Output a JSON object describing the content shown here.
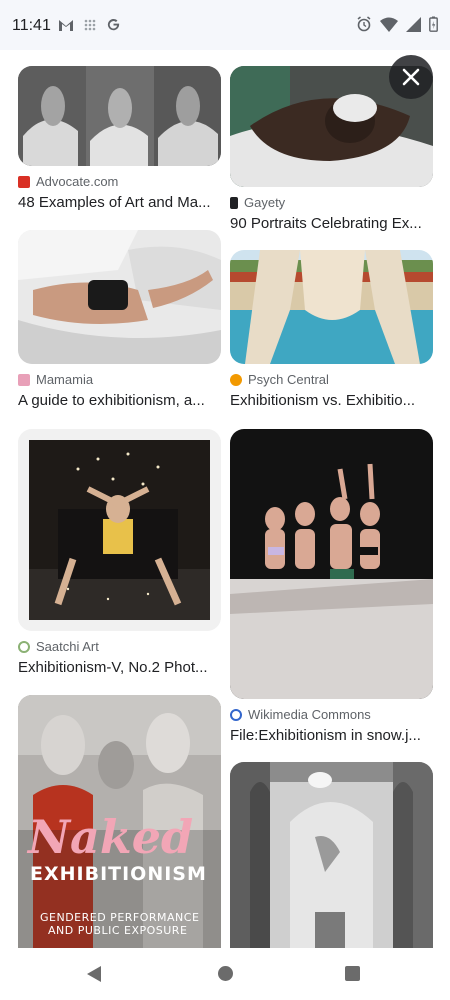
{
  "status_bar": {
    "time": "11:41",
    "left_icons": [
      "gmail-icon",
      "grid-dots-icon",
      "google-icon"
    ],
    "right_icons": [
      "alarm-icon",
      "wifi-icon",
      "signal-icon",
      "battery-icon"
    ]
  },
  "close_button": {
    "icon": "close-icon"
  },
  "results": [
    {
      "source": "Advocate.com",
      "title": "48 Examples of Art and Ma...",
      "fav_color": "#d93025"
    },
    {
      "source": "Gayety",
      "title": "90 Portraits Celebrating Ex...",
      "fav_color": "#202124"
    },
    {
      "source": "Mamamia",
      "title": "A guide to exhibitionism, a...",
      "fav_color": "#e8a0b8"
    },
    {
      "source": "Psych Central",
      "title": "Exhibitionism vs. Exhibitio...",
      "fav_color": "#f29900"
    },
    {
      "source": "Saatchi Art",
      "title": "Exhibitionism-V, No.2 Phot...",
      "fav_color": "#8bb174"
    },
    {
      "source": "Wikimedia Commons",
      "title": "File:Exhibitionism in snow.j...",
      "fav_color": "#3366cc"
    }
  ],
  "book_cover": {
    "title_line1": "Naked",
    "title_line2": "EXHIBITIONISM",
    "subtitle_line1": "GENDERED PERFORMANCE",
    "subtitle_line2": "AND PUBLIC EXPOSURE"
  },
  "nav_bar": {
    "back": "back-icon",
    "home": "home-icon",
    "recents": "recents-icon"
  }
}
